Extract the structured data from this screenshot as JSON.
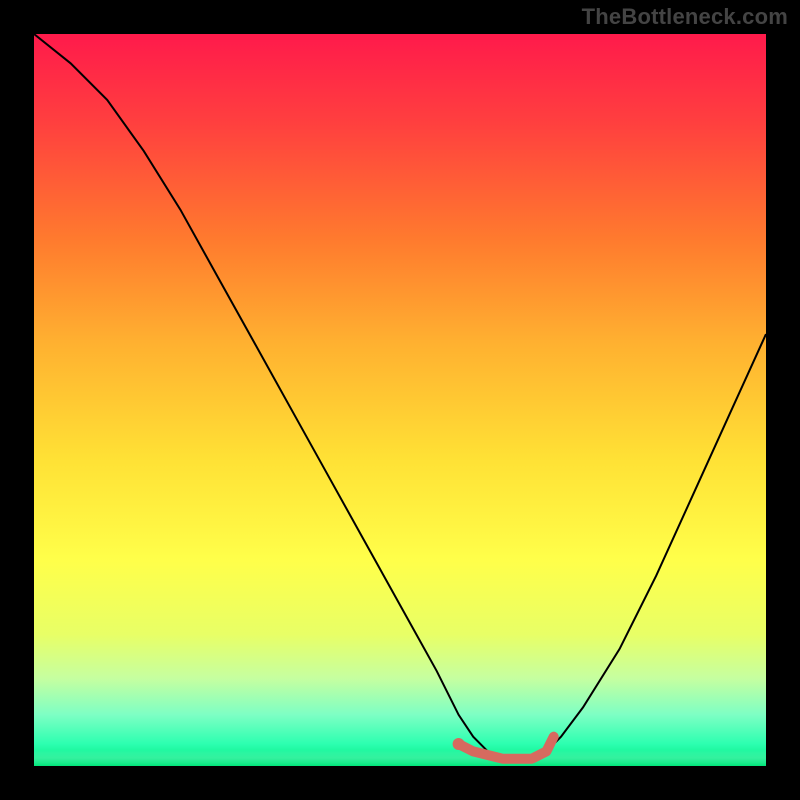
{
  "watermark": "TheBottleneck.com",
  "colors": {
    "background": "#000000",
    "curve": "#000000",
    "marker": "#d66a5f"
  },
  "chart_data": {
    "type": "line",
    "title": "",
    "xlabel": "",
    "ylabel": "",
    "xlim": [
      0,
      100
    ],
    "ylim": [
      0,
      100
    ],
    "series": [
      {
        "name": "bottleneck-curve",
        "x": [
          0,
          5,
          10,
          15,
          20,
          25,
          30,
          35,
          40,
          45,
          50,
          55,
          58,
          60,
          62,
          65,
          68,
          70,
          72,
          75,
          80,
          85,
          90,
          95,
          100
        ],
        "y": [
          100,
          96,
          91,
          84,
          76,
          67,
          58,
          49,
          40,
          31,
          22,
          13,
          7,
          4,
          2,
          1,
          1,
          2,
          4,
          8,
          16,
          26,
          37,
          48,
          59
        ]
      }
    ],
    "markers": {
      "name": "optimal-range",
      "x": [
        58,
        60,
        64,
        68,
        70,
        71
      ],
      "y": [
        3,
        2,
        1,
        1,
        2,
        4
      ]
    },
    "marker_dot": {
      "x": 58,
      "y": 3
    },
    "gradient_stops": [
      {
        "pos": 0,
        "color": "#ff1a4b"
      },
      {
        "pos": 50,
        "color": "#ffe135"
      },
      {
        "pos": 100,
        "color": "#00e67a"
      }
    ]
  }
}
